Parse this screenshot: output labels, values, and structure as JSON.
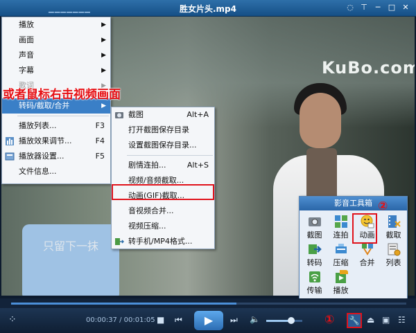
{
  "window": {
    "title": "胜女片头.mp4",
    "logo_dashes": "▁▁▁▁▁▁▁"
  },
  "video": {
    "watermark": "KuBo.com",
    "subtitle": "只留下一抹"
  },
  "annotation": {
    "text": "或者鼠标右击视频画面",
    "circle_1": "①",
    "circle_2": "②"
  },
  "main_menu": {
    "items": [
      {
        "label": "播放",
        "arrow": "▶"
      },
      {
        "label": "画面",
        "arrow": "▶"
      },
      {
        "label": "声音",
        "arrow": "▶"
      },
      {
        "label": "字幕",
        "arrow": "▶"
      },
      {
        "label": "歌词",
        "arrow": "▶"
      },
      {
        "label": "转码/截取/合并",
        "arrow": "▶"
      },
      {
        "label": "播放列表...",
        "shortcut": "F3"
      },
      {
        "label": "播放效果调节...",
        "shortcut": "F4"
      },
      {
        "label": "播放器设置...",
        "shortcut": "F5"
      },
      {
        "label": "文件信息..."
      }
    ]
  },
  "sub_menu": {
    "items": [
      {
        "label": "截图",
        "shortcut": "Alt+A"
      },
      {
        "label": "打开截图保存目录"
      },
      {
        "label": "设置截图保存目录..."
      },
      {
        "label": "剧情连拍...",
        "shortcut": "Alt+S"
      },
      {
        "label": "视频/音频截取..."
      },
      {
        "label": "动画(GIF)截取..."
      },
      {
        "label": "音视频合并..."
      },
      {
        "label": "视频压缩..."
      },
      {
        "label": "转手机/MP4格式..."
      }
    ]
  },
  "toolbox": {
    "title": "影音工具箱",
    "tools": [
      {
        "label": "截图",
        "icon": "camera-icon"
      },
      {
        "label": "连拍",
        "icon": "burst-icon"
      },
      {
        "label": "动画",
        "icon": "gif-smiley-icon"
      },
      {
        "label": "截取",
        "icon": "film-cut-icon"
      },
      {
        "label": "转码",
        "icon": "convert-icon"
      },
      {
        "label": "压缩",
        "icon": "compress-icon"
      },
      {
        "label": "合并",
        "icon": "merge-icon"
      },
      {
        "label": "列表",
        "icon": "list-gear-icon"
      },
      {
        "label": "传输",
        "icon": "wifi-icon"
      },
      {
        "label": "播放",
        "icon": "play-new-icon",
        "badge": "NEW"
      }
    ]
  },
  "player": {
    "time_current": "00:00:37",
    "time_separator": " / ",
    "time_total": "00:01:05",
    "progress": 0.57,
    "volume": 0.7
  },
  "colors": {
    "highlight": "#3a7fc7",
    "annotation_red": "#e60f14",
    "title_bar": "#1f5f99"
  }
}
